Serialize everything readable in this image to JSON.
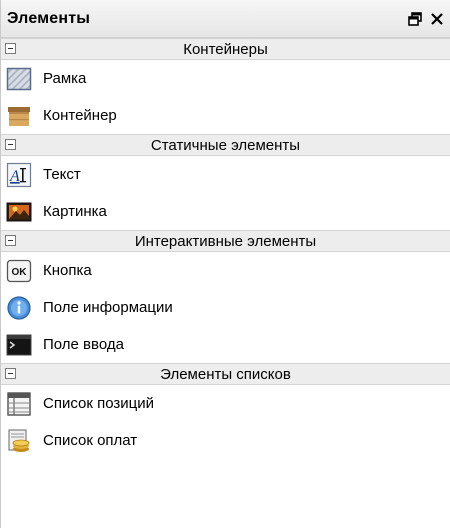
{
  "panel": {
    "title": "Элементы",
    "float_glyph": "🗗",
    "close_glyph": "×"
  },
  "groups": [
    {
      "label": "Контейнеры",
      "items": [
        {
          "label": "Рамка",
          "icon": "frame-icon"
        },
        {
          "label": "Контейнер",
          "icon": "container-icon"
        }
      ]
    },
    {
      "label": "Статичные элементы",
      "items": [
        {
          "label": "Текст",
          "icon": "text-icon",
          "glyph": "AI"
        },
        {
          "label": "Картинка",
          "icon": "picture-icon"
        }
      ]
    },
    {
      "label": "Интерактивные элементы",
      "items": [
        {
          "label": "Кнопка",
          "icon": "ok-button-icon",
          "glyph": "OK"
        },
        {
          "label": "Поле информации",
          "icon": "info-icon",
          "glyph": "i"
        },
        {
          "label": "Поле ввода",
          "icon": "input-field-icon"
        }
      ]
    },
    {
      "label": "Элементы списков",
      "items": [
        {
          "label": "Список позиций",
          "icon": "positions-list-icon"
        },
        {
          "label": "Список оплат",
          "icon": "payments-list-icon"
        }
      ]
    }
  ]
}
